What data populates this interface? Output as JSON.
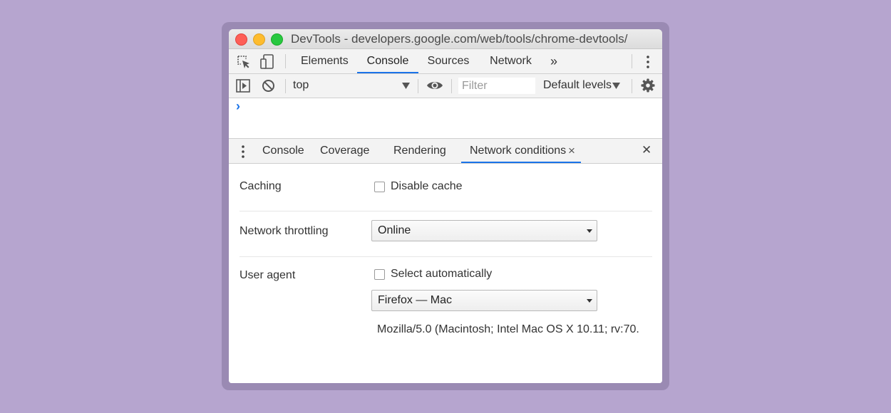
{
  "window": {
    "title": "DevTools - developers.google.com/web/tools/chrome-devtools/"
  },
  "main_tabs": {
    "elements": "Elements",
    "console": "Console",
    "sources": "Sources",
    "network": "Network",
    "more": "»"
  },
  "console_toolbar": {
    "context": "top",
    "filter_placeholder": "Filter",
    "levels": "Default levels"
  },
  "console": {
    "prompt": "›"
  },
  "drawer": {
    "tabs": {
      "console": "Console",
      "coverage": "Coverage",
      "rendering": "Rendering",
      "network_conditions": "Network conditions",
      "close_tab": "×"
    },
    "close": "✕"
  },
  "network_conditions": {
    "caching_label": "Caching",
    "disable_cache_label": "Disable cache",
    "throttling_label": "Network throttling",
    "throttling_value": "Online",
    "user_agent_label": "User agent",
    "select_automatically_label": "Select automatically",
    "user_agent_value": "Firefox — Mac",
    "user_agent_string": "Mozilla/5.0 (Macintosh; Intel Mac OS X 10.11; rv:70."
  },
  "colors": {
    "accent": "#1a73e8",
    "background": "#b6a5cf"
  }
}
